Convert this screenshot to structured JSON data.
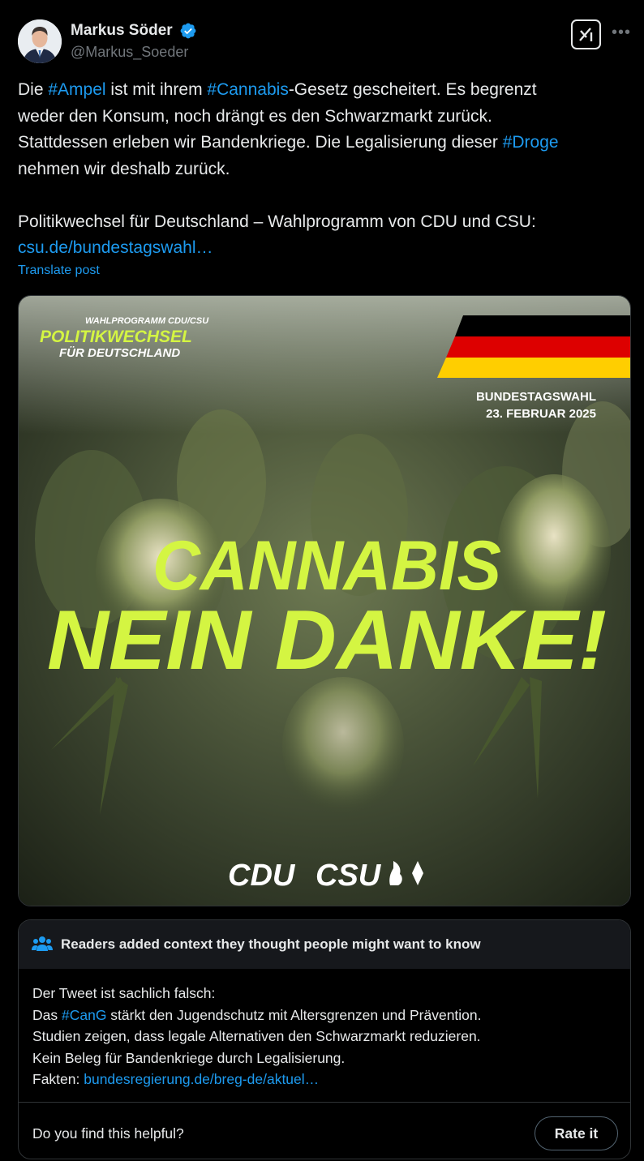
{
  "author": {
    "name": "Markus Söder",
    "handle": "@Markus_Soeder"
  },
  "tweet": {
    "line1": {
      "t1": "Die ",
      "tag1": "#Ampel",
      "t2": " ist mit ihrem ",
      "tag2": "#Cannabis",
      "t3": "-Gesetz gescheitert. Es begrenzt"
    },
    "line2": "weder den Konsum, noch drängt es den Schwarzmarkt zurück.",
    "line3": {
      "t1": "Stattdessen erleben wir Bandenkriege. Die Legalisierung dieser ",
      "tag": "#Droge"
    },
    "line4": "nehmen wir deshalb zurück.",
    "line5": "Politikwechsel für Deutschland – Wahlprogramm von CDU und CSU:",
    "link": "csu.de/bundestagswahl…",
    "translate": "Translate post"
  },
  "image": {
    "kicker": "WAHLPROGRAMM CDU/CSU",
    "title": "POLITIKWECHSEL",
    "subtitle": "FÜR DEUTSCHLAND",
    "election": "BUNDESTAGSWAHL",
    "date": "23. FEBRUAR 2025",
    "headline1": "CANNABIS",
    "headline2": "NEIN DANKE!",
    "party1": "CDU",
    "party2": "CSU",
    "accent_color": "#d4f542",
    "flag_colors": [
      "#000000",
      "#dd0000",
      "#ffce00"
    ]
  },
  "note": {
    "title": "Readers added context they thought people might want to know",
    "line1": "Der Tweet ist sachlich falsch:",
    "line2": {
      "t1": "Das ",
      "tag": "#CanG",
      "t2": " stärkt den Jugendschutz mit Altersgrenzen und Prävention."
    },
    "line3": "Studien zeigen, dass legale Alternativen den Schwarzmarkt reduzieren.",
    "line4": "Kein Beleg für Bandenkriege durch Legalisierung.",
    "line5": {
      "t1": "Fakten: ",
      "link": "bundesregierung.de/breg-de/aktuel…"
    },
    "question": "Do you find this helpful?",
    "rate_label": "Rate it"
  },
  "colors": {
    "link": "#1d9bf0",
    "verified": "#1d9bf0",
    "background": "#000000"
  }
}
